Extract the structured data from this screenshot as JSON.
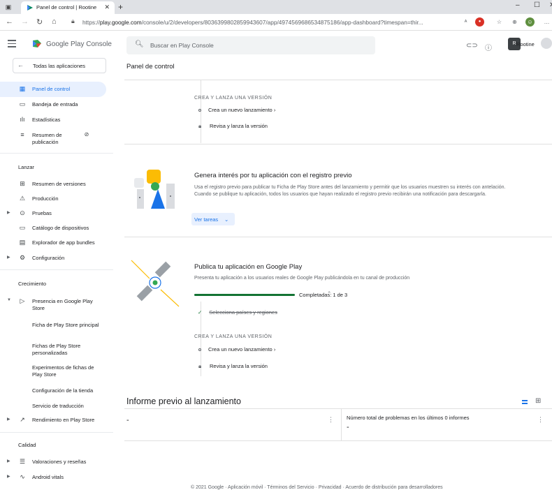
{
  "browser": {
    "tab_title": "Panel de control | Rootine",
    "url_host": "play.google.com",
    "url_prefix": "https://",
    "url_path": "/console/u/2/developers/8036399802859943607/app/4974569686534875186/app-dashboard?timespan=thir..."
  },
  "header": {
    "product_name": "Google Play Console",
    "search_placeholder": "Buscar en Play Console",
    "account_initial": "R",
    "account_name": "Rootine"
  },
  "sidebar": {
    "all_apps": "Todas las aplicaciones",
    "top_items": [
      {
        "label": "Panel de control",
        "icon": "dashboard-icon"
      },
      {
        "label": "Bandeja de entrada",
        "icon": "inbox-icon"
      },
      {
        "label": "Estadísticas",
        "icon": "bar-chart-icon"
      },
      {
        "label": "Resumen de publicación",
        "icon": "publishing-icon"
      }
    ],
    "section_launch": "Lanzar",
    "launch_items": [
      {
        "label": "Resumen de versiones",
        "icon": "releases-icon"
      },
      {
        "label": "Producción",
        "icon": "production-icon"
      },
      {
        "label": "Pruebas",
        "icon": "testing-icon"
      },
      {
        "label": "Catálogo de dispositivos",
        "icon": "devices-icon"
      },
      {
        "label": "Explorador de app bundles",
        "icon": "bundle-icon"
      },
      {
        "label": "Configuración",
        "icon": "settings-icon"
      }
    ],
    "section_growth": "Crecimiento",
    "growth_item": "Presencia en Google Play Store",
    "growth_subitems": [
      "Ficha de Play Store principal",
      "Fichas de Play Store personalizadas",
      "Experimentos de fichas de Play Store",
      "Configuración de la tienda",
      "Servicio de traducción"
    ],
    "performance_item": "Rendimiento en Play Store",
    "section_quality": "Calidad",
    "quality_items": [
      "Valoraciones y reseñas",
      "Android vitals"
    ]
  },
  "main": {
    "page_title": "Panel de control",
    "step1": {
      "heading": "CREA Y LANZA UNA VERSIÓN",
      "row1": "Crea un nuevo lanzamiento",
      "row2": "Revisa y lanza la versión"
    },
    "prereg": {
      "title": "Genera interés por tu aplicación con el registro previo",
      "body": "Usa el registro previo para publicar tu Ficha de Play Store antes del lanzamiento y permitir que los usuarios muestren su interés con antelación. Cuando se publique tu aplicación, todos los usuarios que hayan realizado el registro previo recibirán una notificación para descargarla.",
      "button": "Ver tareas"
    },
    "publish": {
      "title": "Publica tu aplicación en Google Play",
      "body": "Presenta tu aplicación a los usuarios reales de Google Play publicándola en tu canal de producción",
      "progress_label": "Completadas: 1 de 3",
      "progress_fraction": 0.33,
      "done_item": "Selecciona países y regiones",
      "heading": "CREA Y LANZA UNA VERSIÓN",
      "row1": "Crea un nuevo lanzamiento",
      "row2": "Revisa y lanza la versión"
    },
    "report": {
      "title": "Informe previo al lanzamiento",
      "left_value": "-",
      "right_label": "Número total de problemas en los últimos 0 informes",
      "right_value": "-"
    },
    "footer": "© 2021 Google · Aplicación móvil · Términos del Servicio · Privacidad · Acuerdo de distribución para desarrolladores"
  },
  "colors": {
    "accent": "#1a73e8",
    "progress": "#137333",
    "active_bg": "#e8f0fe"
  }
}
